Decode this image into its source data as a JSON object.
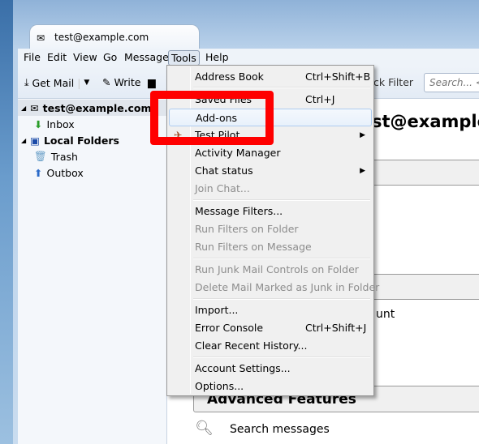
{
  "window": {
    "tab_title": "test@example.com"
  },
  "menubar": [
    "File",
    "Edit",
    "View",
    "Go",
    "Message",
    "Tools",
    "Help"
  ],
  "toolbar": {
    "get_mail": "Get Mail",
    "write": "Write",
    "quick_filter": "ck Filter",
    "search_placeholder": "Search... <C"
  },
  "folders": [
    {
      "label": "test@example.com",
      "bold": true,
      "icon": "account-icon"
    },
    {
      "label": "Inbox",
      "icon": "inbox-icon"
    },
    {
      "label": "Local Folders",
      "bold": true,
      "icon": "local-folders-icon"
    },
    {
      "label": "Trash",
      "icon": "trash-icon"
    },
    {
      "label": "Outbox",
      "icon": "outbox-icon"
    }
  ],
  "main": {
    "heading": "st@example",
    "account_fragment": "unt",
    "advanced": "Advanced Features",
    "search_messages": "Search messages"
  },
  "tools_menu": [
    {
      "label": "Address Book",
      "shortcut": "Ctrl+Shift+B"
    },
    {
      "label": "Saved Files",
      "shortcut": "Ctrl+J"
    },
    {
      "label": "Add-ons",
      "highlighted": true
    },
    {
      "label": "Test Pilot",
      "submenu": true
    },
    {
      "label": "Activity Manager"
    },
    {
      "label": "Chat status",
      "submenu": true
    },
    {
      "label": "Join Chat...",
      "disabled": true
    },
    {
      "label": "Message Filters..."
    },
    {
      "label": "Run Filters on Folder",
      "disabled": true
    },
    {
      "label": "Run Filters on Message",
      "disabled": true
    },
    {
      "label": "Run Junk Mail Controls on Folder",
      "disabled": true
    },
    {
      "label": "Delete Mail Marked as Junk in Folder",
      "disabled": true
    },
    {
      "label": "Import..."
    },
    {
      "label": "Error Console",
      "shortcut": "Ctrl+Shift+J"
    },
    {
      "label": "Clear Recent History..."
    },
    {
      "label": "Account Settings..."
    },
    {
      "label": "Options..."
    }
  ],
  "colors": {
    "highlight_box": "#ff0000",
    "menu_bg": "#f0f0f0"
  }
}
